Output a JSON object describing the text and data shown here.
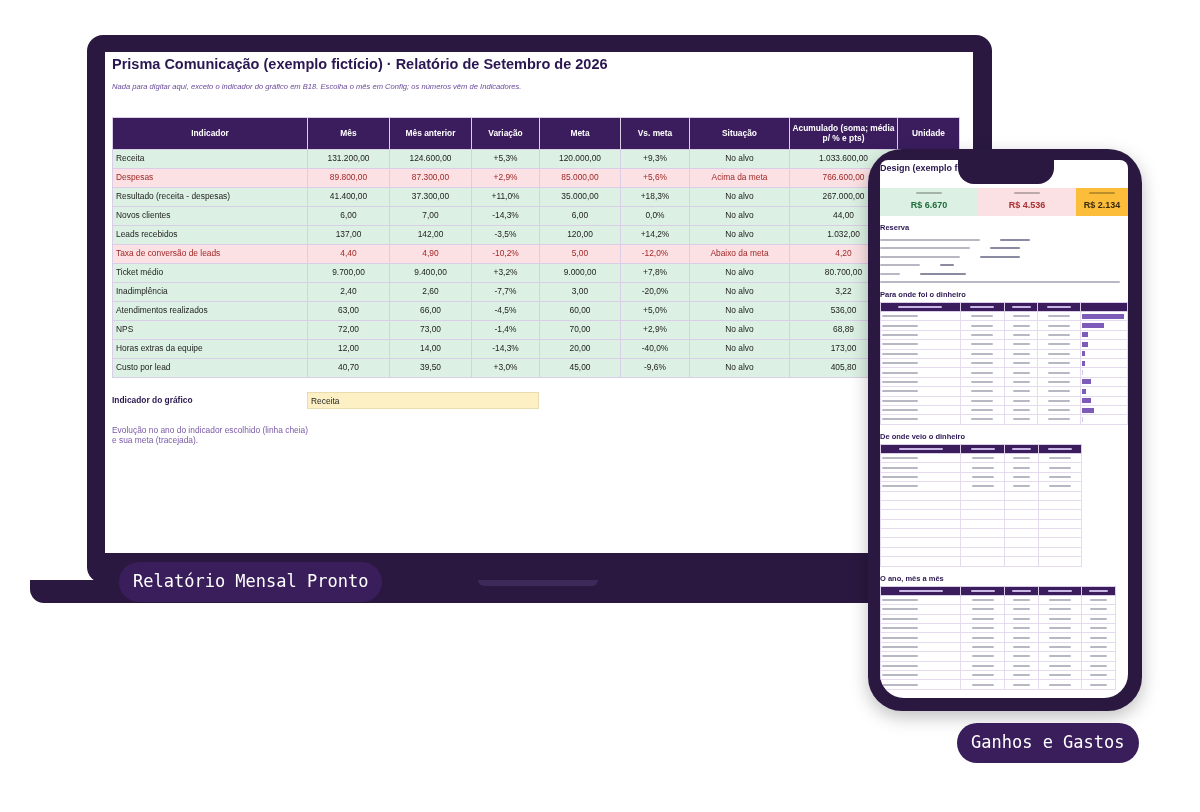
{
  "laptop": {
    "title": "Prisma Comunicação (exemplo fictício) · Relatório de Setembro de 2026",
    "subtitle": "Nada para digitar aqui, exceto o indicador do gráfico em B18. Escolha o mês em Config; os números vêm de Indicadores.",
    "table": {
      "columns": [
        "Indicador",
        "Mês",
        "Mês anterior",
        "Variação",
        "Meta",
        "Vs. meta",
        "Situação",
        "Acumulado (soma; média p/ % e pts)",
        "Unidade"
      ],
      "rows": [
        {
          "alert": false,
          "cells": [
            "Receita",
            "131.200,00",
            "124.600,00",
            "+5,3%",
            "120.000,00",
            "+9,3%",
            "No alvo",
            "1.033.600,00"
          ]
        },
        {
          "alert": true,
          "cells": [
            "Despesas",
            "89.800,00",
            "87.300,00",
            "+2,9%",
            "85.000,00",
            "+5,6%",
            "Acima da meta",
            "766.600,00"
          ]
        },
        {
          "alert": false,
          "cells": [
            "Resultado (receita - despesas)",
            "41.400,00",
            "37.300,00",
            "+11,0%",
            "35.000,00",
            "+18,3%",
            "No alvo",
            "267.000,00"
          ]
        },
        {
          "alert": false,
          "cells": [
            "Novos clientes",
            "6,00",
            "7,00",
            "-14,3%",
            "6,00",
            "0,0%",
            "No alvo",
            "44,00"
          ]
        },
        {
          "alert": false,
          "cells": [
            "Leads recebidos",
            "137,00",
            "142,00",
            "-3,5%",
            "120,00",
            "+14,2%",
            "No alvo",
            "1.032,00"
          ]
        },
        {
          "alert": true,
          "cells": [
            "Taxa de conversão de leads",
            "4,40",
            "4,90",
            "-10,2%",
            "5,00",
            "-12,0%",
            "Abaixo da meta",
            "4,20"
          ]
        },
        {
          "alert": false,
          "cells": [
            "Ticket médio",
            "9.700,00",
            "9.400,00",
            "+3,2%",
            "9.000,00",
            "+7,8%",
            "No alvo",
            "80.700,00"
          ]
        },
        {
          "alert": false,
          "cells": [
            "Inadimplência",
            "2,40",
            "2,60",
            "-7,7%",
            "3,00",
            "-20,0%",
            "No alvo",
            "3,22"
          ]
        },
        {
          "alert": false,
          "cells": [
            "Atendimentos realizados",
            "63,00",
            "66,00",
            "-4,5%",
            "60,00",
            "+5,0%",
            "No alvo",
            "536,00"
          ]
        },
        {
          "alert": false,
          "cells": [
            "NPS",
            "72,00",
            "73,00",
            "-1,4%",
            "70,00",
            "+2,9%",
            "No alvo",
            "68,89"
          ]
        },
        {
          "alert": false,
          "cells": [
            "Horas extras da equipe",
            "12,00",
            "14,00",
            "-14,3%",
            "20,00",
            "-40,0%",
            "No alvo",
            "173,00"
          ]
        },
        {
          "alert": false,
          "cells": [
            "Custo por lead",
            "40,70",
            "39,50",
            "+3,0%",
            "45,00",
            "-9,6%",
            "No alvo",
            "405,80"
          ]
        }
      ]
    },
    "chart_selector": {
      "label": "Indicador do gráfico",
      "value": "Receita"
    },
    "chart_note": "Evolução no ano do indicador escolhido (linha cheia) e sua meta (tracejada)."
  },
  "laptop_caption": "Relatório Mensal Pronto",
  "phone": {
    "title": "Design (exemplo f",
    "summary": [
      {
        "kind": "in",
        "value": "R$ 6.670"
      },
      {
        "kind": "out",
        "value": "R$ 4.536"
      },
      {
        "kind": "left",
        "value": "R$ 2.134"
      }
    ],
    "reserve": {
      "title": "Reserva"
    },
    "expenses": {
      "title": "Para onde foi o dinheiro",
      "bars": [
        {
          "level": 0.95
        },
        {
          "level": 0.5
        },
        {
          "level": 0.14
        },
        {
          "level": 0.12
        },
        {
          "level": 0.07
        },
        {
          "level": 0.07
        },
        {
          "level": 0
        },
        {
          "level": 0.2
        },
        {
          "level": 0.08
        },
        {
          "level": 0.2
        },
        {
          "level": 0.27
        },
        {
          "level": 0
        }
      ]
    },
    "income": {
      "title": "De onde veio o dinheiro"
    },
    "months": {
      "title": "O ano, mês a mês"
    }
  },
  "phone_caption": "Ganhos e Gastos"
}
